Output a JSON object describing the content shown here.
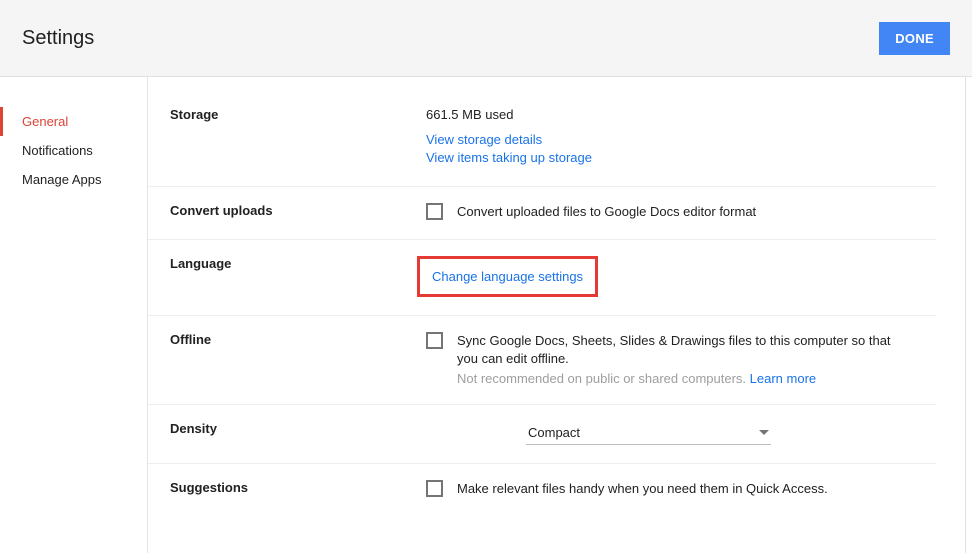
{
  "header": {
    "title": "Settings",
    "done": "DONE"
  },
  "sidebar": {
    "items": [
      {
        "label": "General"
      },
      {
        "label": "Notifications"
      },
      {
        "label": "Manage Apps"
      }
    ]
  },
  "sections": {
    "storage": {
      "label": "Storage",
      "used": "661.5 MB used",
      "link1": "View storage details",
      "link2": "View items taking up storage"
    },
    "convert": {
      "label": "Convert uploads",
      "text": "Convert uploaded files to Google Docs editor format"
    },
    "language": {
      "label": "Language",
      "link": "Change language settings"
    },
    "offline": {
      "label": "Offline",
      "text": "Sync Google Docs, Sheets, Slides & Drawings files to this computer so that you can edit offline.",
      "subtext": "Not recommended on public or shared computers. ",
      "learn": "Learn more"
    },
    "density": {
      "label": "Density",
      "value": "Compact"
    },
    "suggestions": {
      "label": "Suggestions",
      "text": "Make relevant files handy when you need them in Quick Access."
    }
  }
}
